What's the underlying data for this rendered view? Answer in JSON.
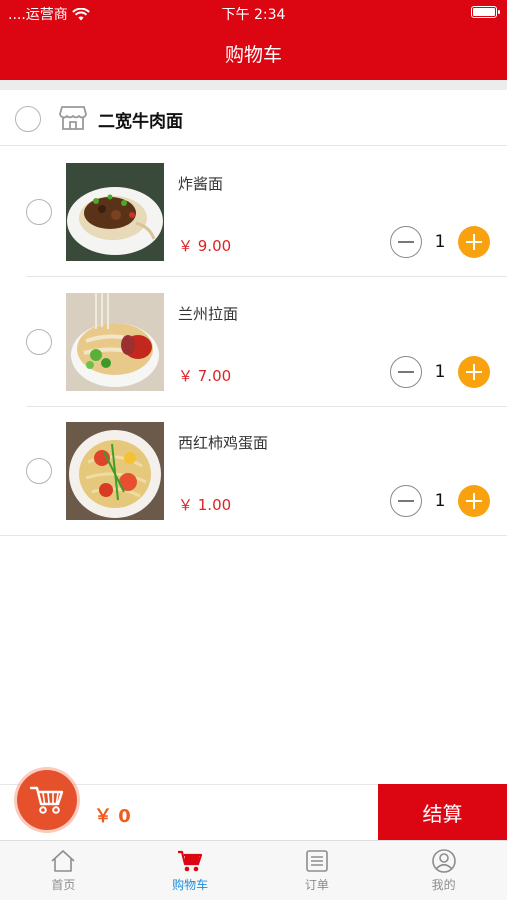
{
  "status_bar": {
    "carrier": "....运营商",
    "time": "下午 2:34"
  },
  "nav": {
    "title": "购物车"
  },
  "shop": {
    "name": "二宽牛肉面"
  },
  "items": [
    {
      "name": "炸酱面",
      "price": "￥ 9.00",
      "qty": "1"
    },
    {
      "name": "兰州拉面",
      "price": "￥ 7.00",
      "qty": "1"
    },
    {
      "name": "西红柿鸡蛋面",
      "price": "￥ 1.00",
      "qty": "1"
    }
  ],
  "checkout": {
    "total": "￥ 0",
    "pay_label": "结算"
  },
  "tabs": [
    {
      "label": "首页",
      "icon": "home-icon",
      "active": false
    },
    {
      "label": "购物车",
      "icon": "cart-icon",
      "active": true
    },
    {
      "label": "订单",
      "icon": "list-icon",
      "active": false
    },
    {
      "label": "我的",
      "icon": "user-icon",
      "active": false
    }
  ],
  "colors": {
    "brand_red": "#dc0612",
    "accent_orange": "#f8a210",
    "price_red": "#dc2424",
    "active_blue": "#1f8ee0"
  }
}
